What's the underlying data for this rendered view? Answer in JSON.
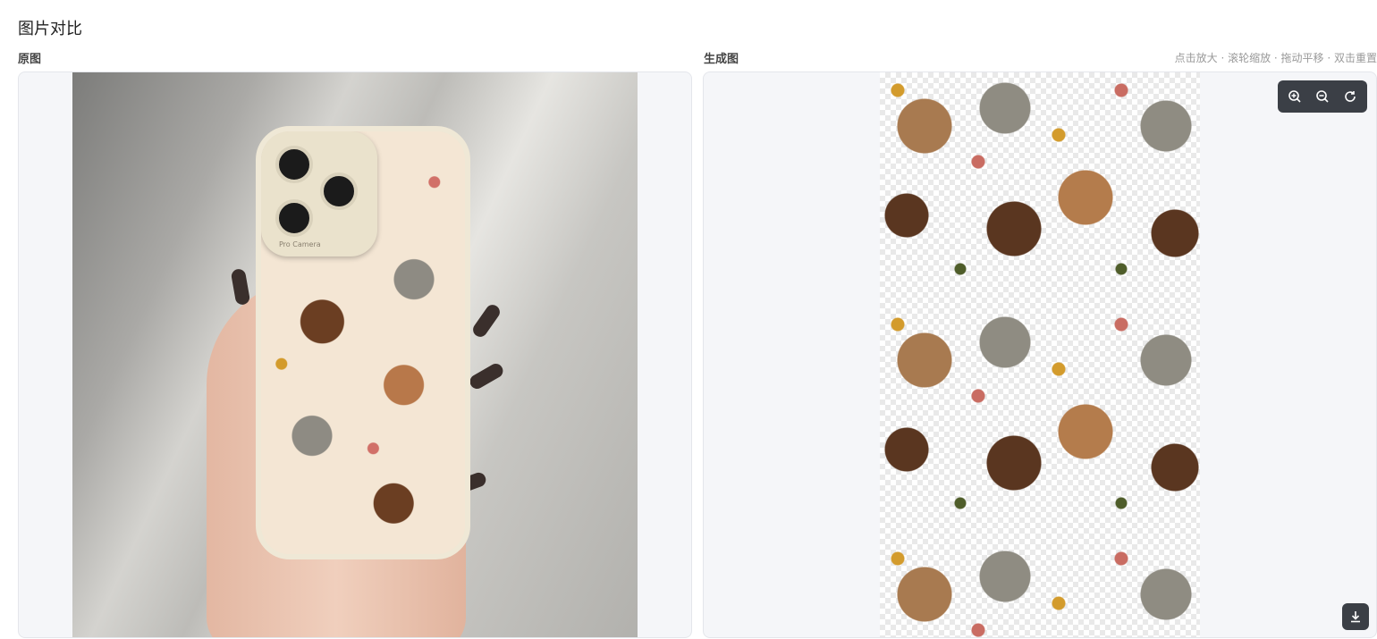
{
  "page": {
    "title": "图片对比"
  },
  "left": {
    "label": "原图",
    "camera_text": "Pro Camera"
  },
  "right": {
    "label": "生成图",
    "hint": "点击放大 · 滚轮缩放 · 拖动平移 · 双击重置"
  },
  "toolbar": {
    "icons": [
      "zoom-in-icon",
      "zoom-out-icon",
      "reset-icon"
    ]
  },
  "download": {
    "icon": "download-icon"
  },
  "colors": {
    "panel_bg": "#f5f6f9",
    "toolbar_bg": "#3b3f46",
    "hen_brown": "#b47c4c",
    "hen_dark": "#5a3620",
    "hen_gray": "#8f8c82",
    "flower_yellow": "#d39b2c",
    "flower_pink": "#c96c62"
  }
}
